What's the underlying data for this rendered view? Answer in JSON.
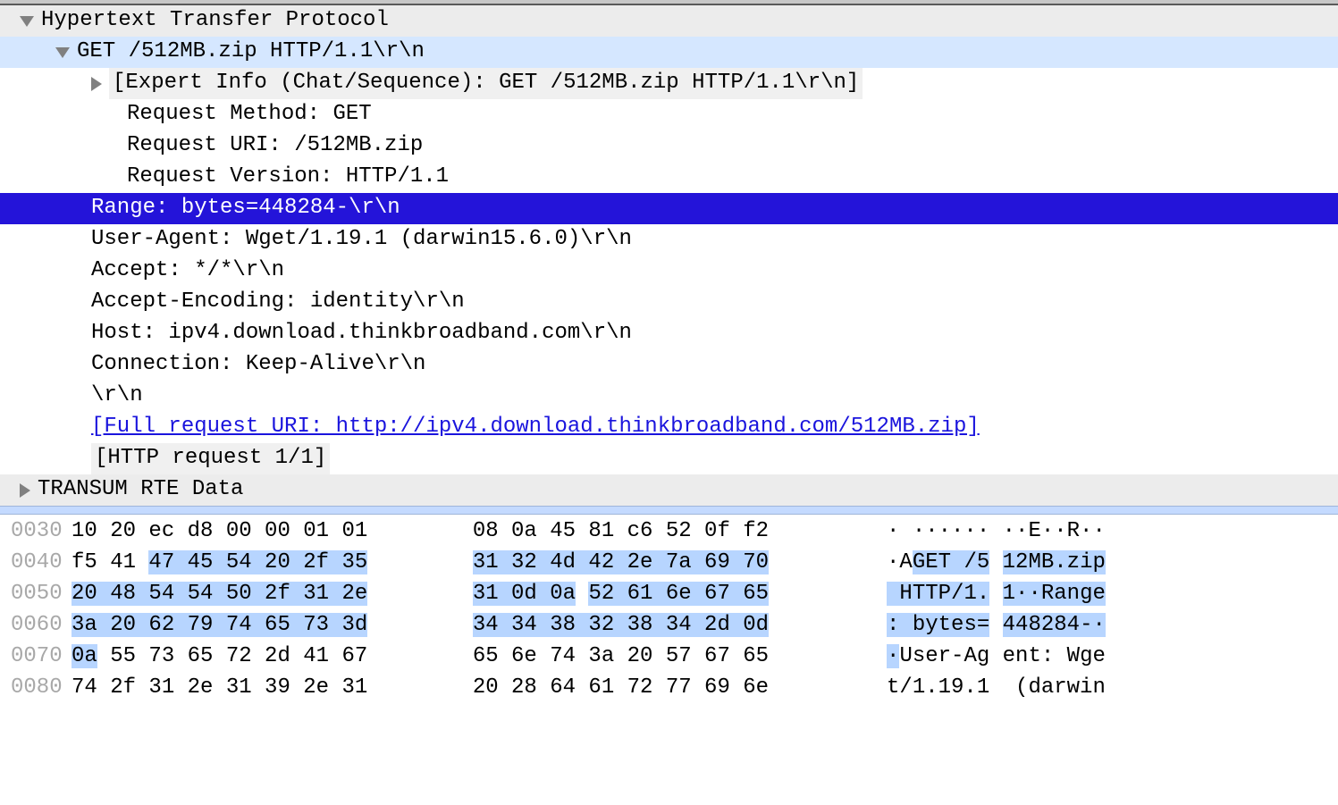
{
  "tree": {
    "http_header": "Hypertext Transfer Protocol",
    "request_line": "GET /512MB.zip HTTP/1.1\\r\\n",
    "expert_info": "[Expert Info (Chat/Sequence): GET /512MB.zip HTTP/1.1\\r\\n]",
    "method": "Request Method: GET",
    "uri": "Request URI: /512MB.zip",
    "version": "Request Version: HTTP/1.1",
    "range": "Range: bytes=448284-\\r\\n",
    "user_agent": "User-Agent: Wget/1.19.1 (darwin15.6.0)\\r\\n",
    "accept": "Accept: */*\\r\\n",
    "accept_encoding": "Accept-Encoding: identity\\r\\n",
    "host": "Host: ipv4.download.thinkbroadband.com\\r\\n",
    "connection": "Connection: Keep-Alive\\r\\n",
    "crlf": "\\r\\n",
    "full_uri": "[Full request URI: http://ipv4.download.thinkbroadband.com/512MB.zip]",
    "http_request_count": "[HTTP request 1/1]",
    "transum": "TRANSUM RTE Data"
  },
  "hex": {
    "rows": [
      {
        "offset": "0030",
        "b1": "10 20 ec d8 00 00 01 01",
        "b2": "08 0a 45 81 c6 52 0f f2",
        "a1": "· ······",
        "a2": "··E··R··",
        "hl": "none"
      },
      {
        "offset": "0040",
        "b1": "f5 41 47 45 54 20 2f 35",
        "b2": "31 32 4d 42 2e 7a 69 70",
        "a1": "·AGET /5",
        "a2": "12MB.zip",
        "hl": "get"
      },
      {
        "offset": "0050",
        "b1": "20 48 54 54 50 2f 31 2e",
        "b2": "31 0d 0a 52 61 6e 67 65",
        "a1": " HTTP/1.",
        "a2": "1··Range",
        "hl": "mixed"
      },
      {
        "offset": "0060",
        "b1": "3a 20 62 79 74 65 73 3d",
        "b2": "34 34 38 32 38 34 2d 0d",
        "a1": ": bytes=",
        "a2": "448284-·",
        "hl": "full"
      },
      {
        "offset": "0070",
        "b1": "0a 55 73 65 72 2d 41 67",
        "b2": "65 6e 74 3a 20 57 67 65",
        "a1": "·User-Ag",
        "a2": "ent: Wge",
        "hl": "0a"
      },
      {
        "offset": "0080",
        "b1": "74 2f 31 2e 31 39 2e 31",
        "b2": "20 28 64 61 72 77 69 6e",
        "a1": "t/1.19.1",
        "a2": " (darwin",
        "hl": "none"
      }
    ]
  }
}
